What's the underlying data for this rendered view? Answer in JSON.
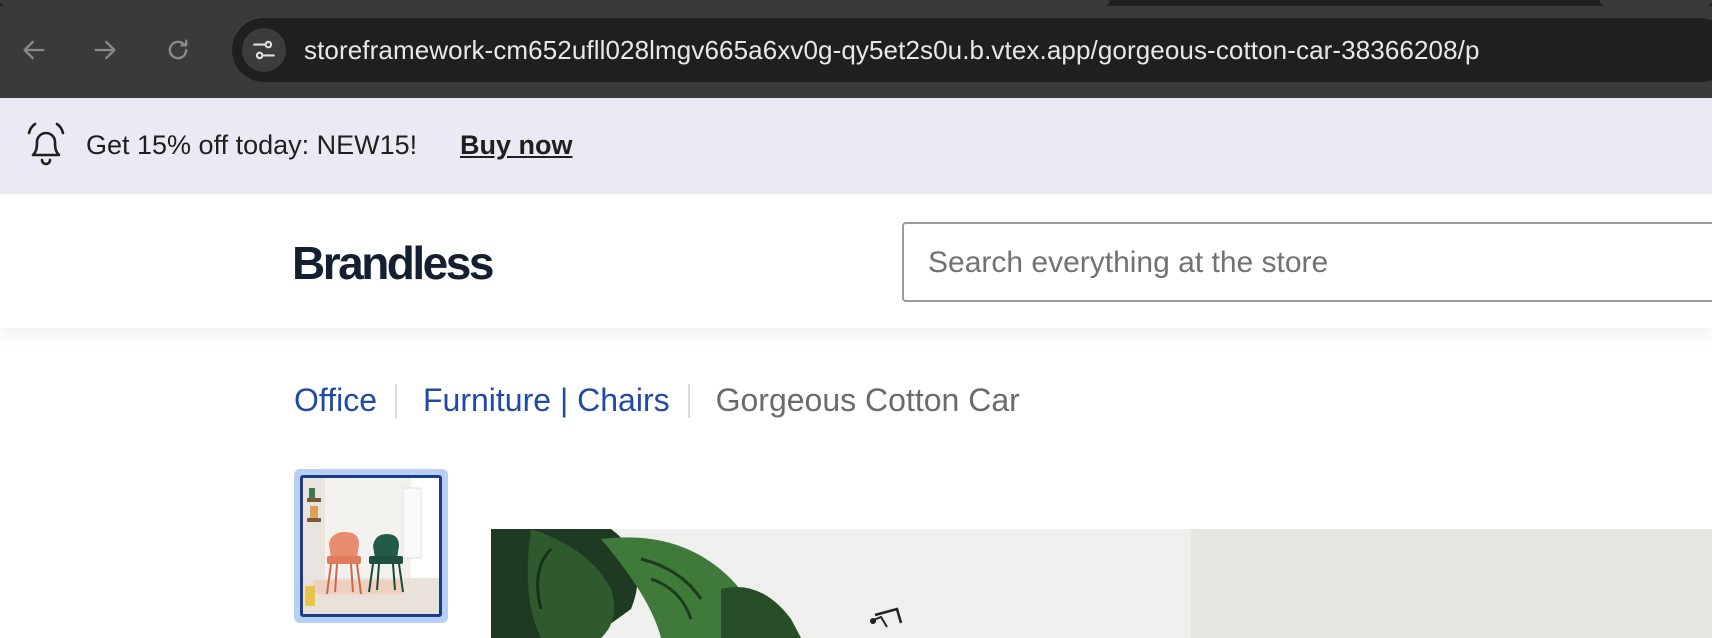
{
  "browser": {
    "url": "storeframework-cm652ufll028lmgv665a6xv0g-qy5et2s0u.b.vtex.app/gorgeous-cotton-car-38366208/p",
    "back_icon": "arrow-left-icon",
    "forward_icon": "arrow-right-icon",
    "reload_icon": "reload-icon",
    "site_info_icon": "tune-icon"
  },
  "promo": {
    "icon": "bell-icon",
    "text": "Get 15% off today: NEW15!",
    "link": "Buy now"
  },
  "header": {
    "logo": "Brandless",
    "search_placeholder": "Search everything at the store"
  },
  "breadcrumb": {
    "items": [
      "Office",
      "Furniture | Chairs"
    ],
    "current": "Gorgeous Cotton Car"
  },
  "colors": {
    "promo_bg": "#ebe9f3",
    "brand": "#142032",
    "link": "#1f4ba7",
    "thumb_selected_border": "#1c3c86"
  }
}
